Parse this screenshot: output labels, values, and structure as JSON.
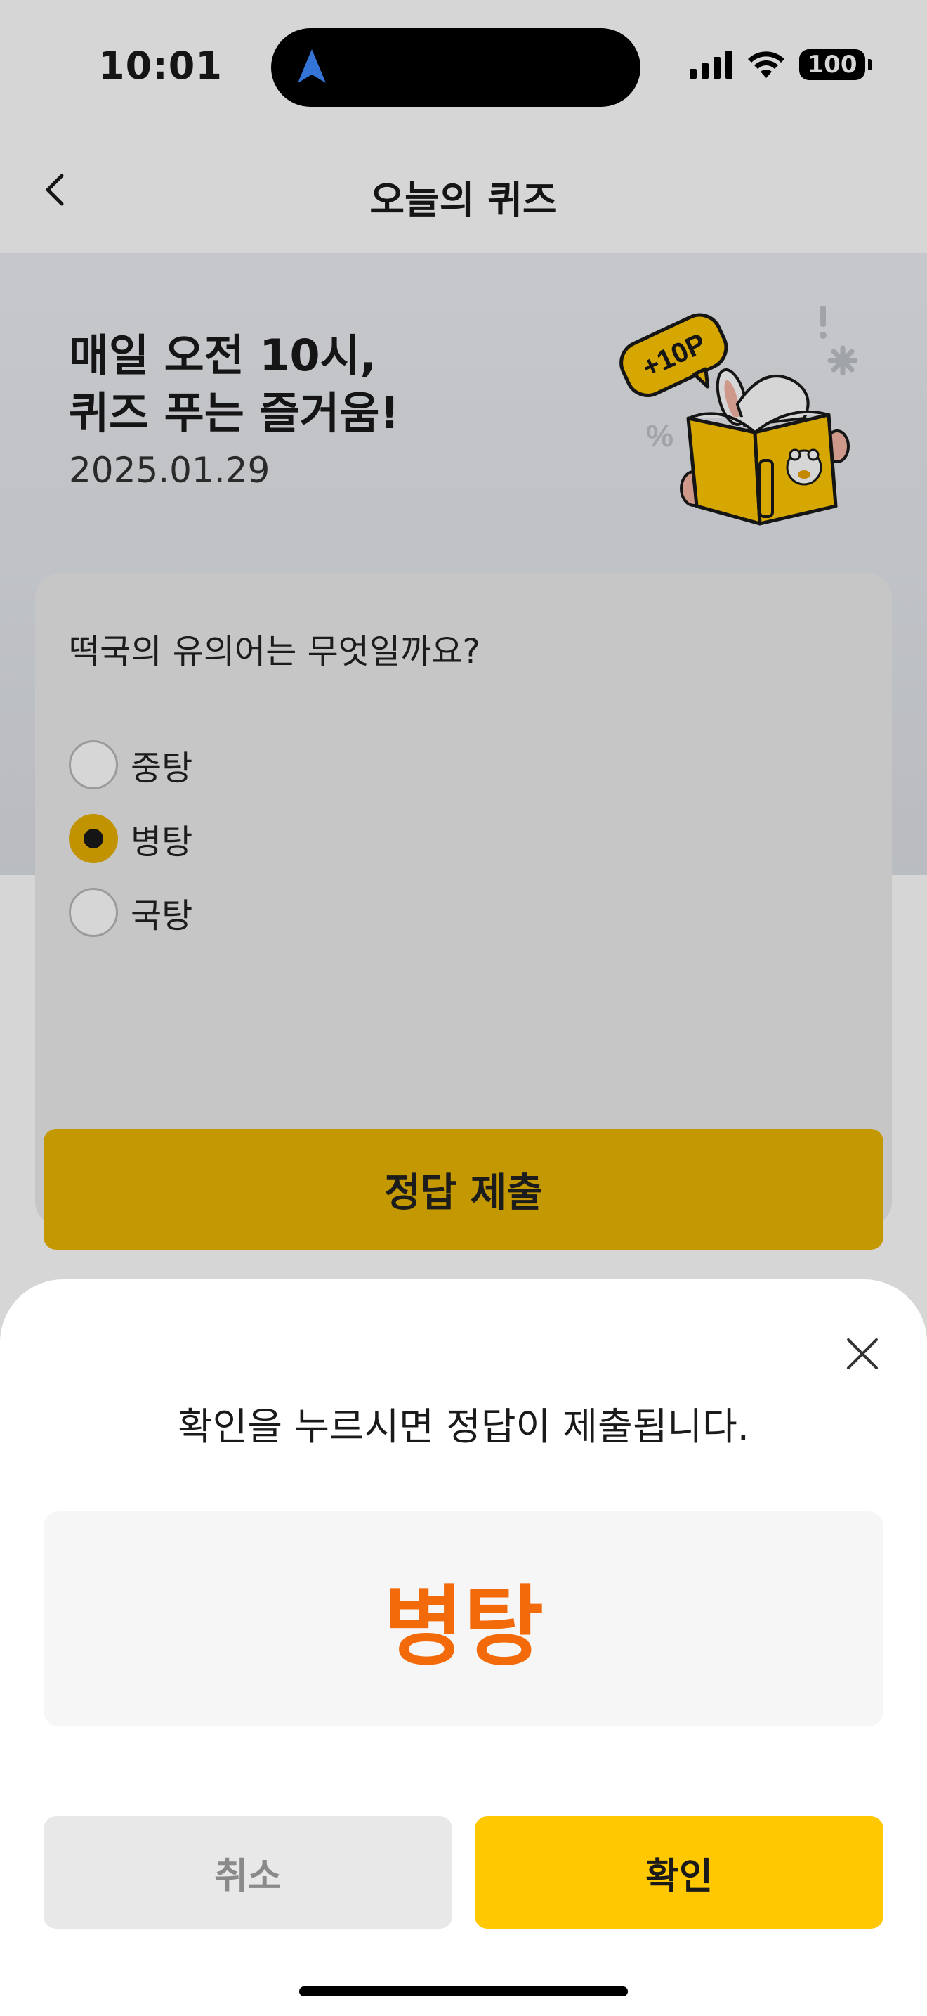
{
  "status": {
    "time": "10:01",
    "battery": "100"
  },
  "header": {
    "title": "오늘의 퀴즈"
  },
  "hero": {
    "title": "매일 오전 10시,\n퀴즈 푸는 즐거움!",
    "date": "2025.01.29",
    "badge": "+10P"
  },
  "quiz": {
    "question": "떡국의 유의어는 무엇일까요?",
    "options": [
      {
        "label": "중탕",
        "selected": false
      },
      {
        "label": "병탕",
        "selected": true
      },
      {
        "label": "국탕",
        "selected": false
      }
    ],
    "submit_label": "정답 제출"
  },
  "sheet": {
    "message": "확인을 누르시면 정답이 제출됩니다.",
    "answer": "병탕",
    "cancel_label": "취소",
    "confirm_label": "확인"
  },
  "colors": {
    "accent": "#ffc800",
    "answer": "#f26a0a",
    "cancel_bg": "#e8e8e8"
  }
}
